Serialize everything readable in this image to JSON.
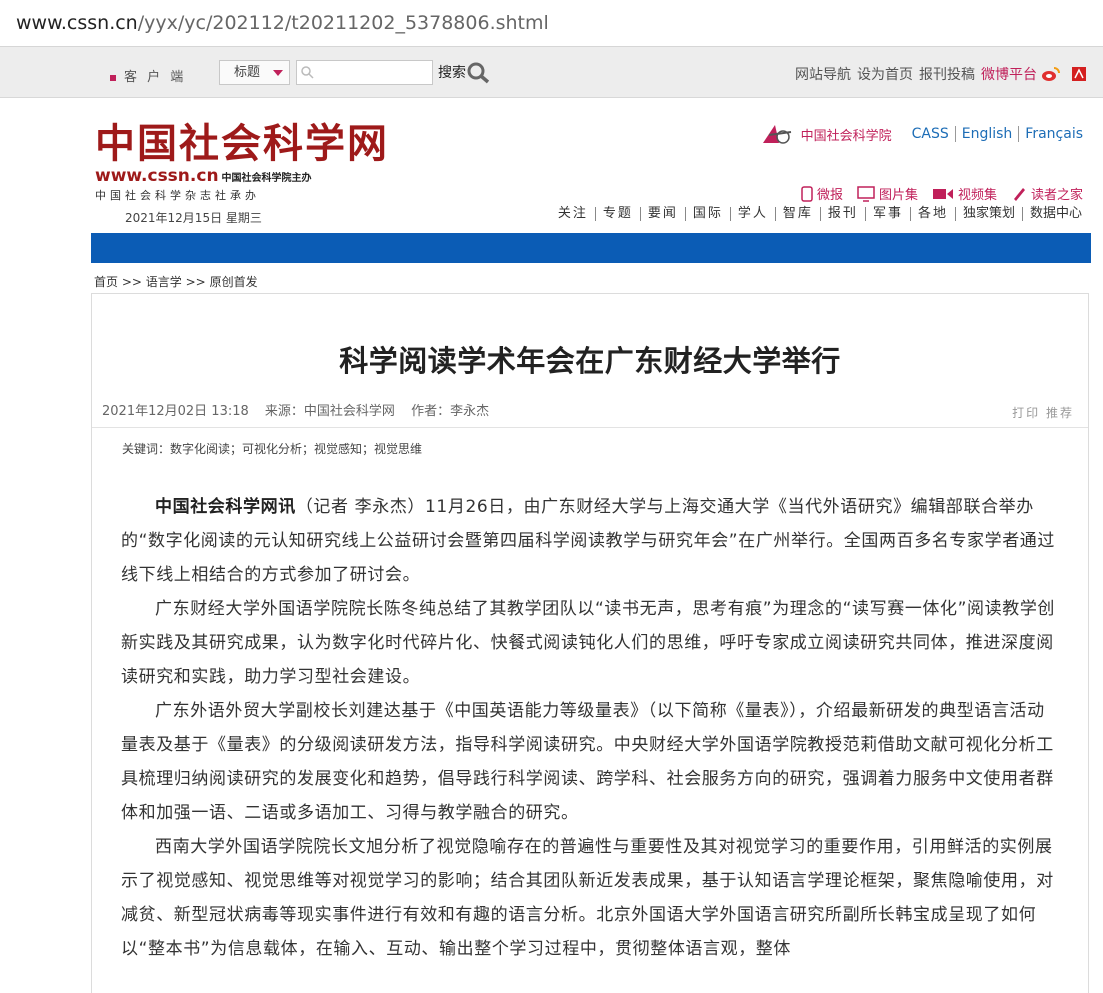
{
  "browser": {
    "url_host": "www.cssn.cn",
    "url_path": "/yyx/yc/202112/t20211202_5378806.shtml"
  },
  "topbar": {
    "client_label": "客 户 端",
    "search_select": "标题",
    "search_button": "搜索",
    "links": [
      "网站导航",
      "设为首页",
      "报刊投稿"
    ],
    "weibo": "微博平台"
  },
  "header": {
    "logo_title": "中国社会科学网",
    "logo_url": "www.cssn.cn",
    "logo_sponsor": "中国社会科学院主办",
    "logo_sub": "中国社会科学杂志社承办",
    "date": "2021年12月15日 星期三",
    "cass_name": "中国社会科学院",
    "langs": [
      "CASS",
      "English",
      "Français"
    ],
    "media": [
      "微报",
      "图片集",
      "视频集",
      "读者之家"
    ],
    "nav": [
      "关注",
      "专题",
      "要闻",
      "国际",
      "学人",
      "智库",
      "报刊",
      "军事",
      "各地",
      "独家策划",
      "数据中心"
    ]
  },
  "breadcrumb": [
    "首页",
    ">>",
    "语言学",
    ">>",
    "原创首发"
  ],
  "article": {
    "title": "科学阅读学术年会在广东财经大学举行",
    "datetime": "2021年12月02日 13:18",
    "source": "来源：中国社会科学网",
    "author": "作者：李永杰",
    "tools": "打印 推荐",
    "keywords": "关键词：数字化阅读；可视化分析；视觉感知；视觉思维",
    "lead_bold": "中国社会科学网讯",
    "p1_rest": "（记者 李永杰）11月26日，由广东财经大学与上海交通大学《当代外语研究》编辑部联合举办的“数字化阅读的元认知研究线上公益研讨会暨第四届科学阅读教学与研究年会”在广州举行。全国两百多名专家学者通过线下线上相结合的方式参加了研讨会。",
    "p2": "广东财经大学外国语学院院长陈冬纯总结了其教学团队以“读书无声，思考有痕”为理念的“读写赛一体化”阅读教学创新实践及其研究成果，认为数字化时代碎片化、快餐式阅读钝化人们的思维，呼吁专家成立阅读研究共同体，推进深度阅读研究和实践，助力学习型社会建设。",
    "p3": "广东外语外贸大学副校长刘建达基于《中国英语能力等级量表》（以下简称《量表》），介绍最新研发的典型语言活动量表及基于《量表》的分级阅读研发方法，指导科学阅读研究。中央财经大学外国语学院教授范莉借助文献可视化分析工具梳理归纳阅读研究的发展变化和趋势，倡导践行科学阅读、跨学科、社会服务方向的研究，强调着力服务中文使用者群体和加强一语、二语或多语加工、习得与教学融合的研究。",
    "p4": "西南大学外国语学院院长文旭分析了视觉隐喻存在的普遍性与重要性及其对视觉学习的重要作用，引用鲜活的实例展示了视觉感知、视觉思维等对视觉学习的影响；结合其团队新近发表成果，基于认知语言学理论框架，聚焦隐喻使用，对减贫、新型冠状病毒等现实事件进行有效和有趣的语言分析。北京外国语大学外国语言研究所副所长韩宝成呈现了如何以“整本书”为信息载体，在输入、互动、输出整个学习过程中，贯彻整体语言观，整体"
  }
}
